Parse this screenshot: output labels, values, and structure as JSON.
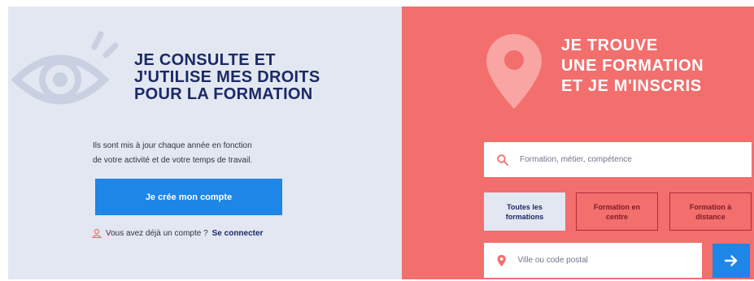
{
  "colors": {
    "left_bg": "#e3e7f1",
    "right_bg": "#f26f6d",
    "heading_navy": "#1b2a66",
    "button_blue": "#1d86e6",
    "outline_red": "#b02c38"
  },
  "icons": {
    "eye": "eye-icon",
    "pin": "map-pin-icon",
    "user": "user-icon",
    "search": "search-icon",
    "location": "location-pin-icon",
    "arrow": "arrow-right-icon"
  },
  "left": {
    "heading": [
      "JE CONSULTE ET",
      "J'UTILISE MES DROITS",
      "POUR LA FORMATION"
    ],
    "info_lines": [
      "Ils sont mis à jour chaque année en fonction",
      "de votre activité et de votre temps de travail."
    ],
    "create_account_label": "Je crée mon compte",
    "login_question": "Vous avez déjà un compte ?",
    "login_link": "Se connecter"
  },
  "right": {
    "heading": [
      "JE TROUVE",
      "UNE FORMATION",
      "ET JE M'INSCRIS"
    ],
    "search_placeholder": "Formation, métier, compétence",
    "filters": [
      {
        "line1": "Toutes les",
        "line2": "formations"
      },
      {
        "line1": "Formation en",
        "line2": "centre"
      },
      {
        "line1": "Formation à",
        "line2": "distance"
      }
    ],
    "city_placeholder": "Ville ou code postal"
  }
}
